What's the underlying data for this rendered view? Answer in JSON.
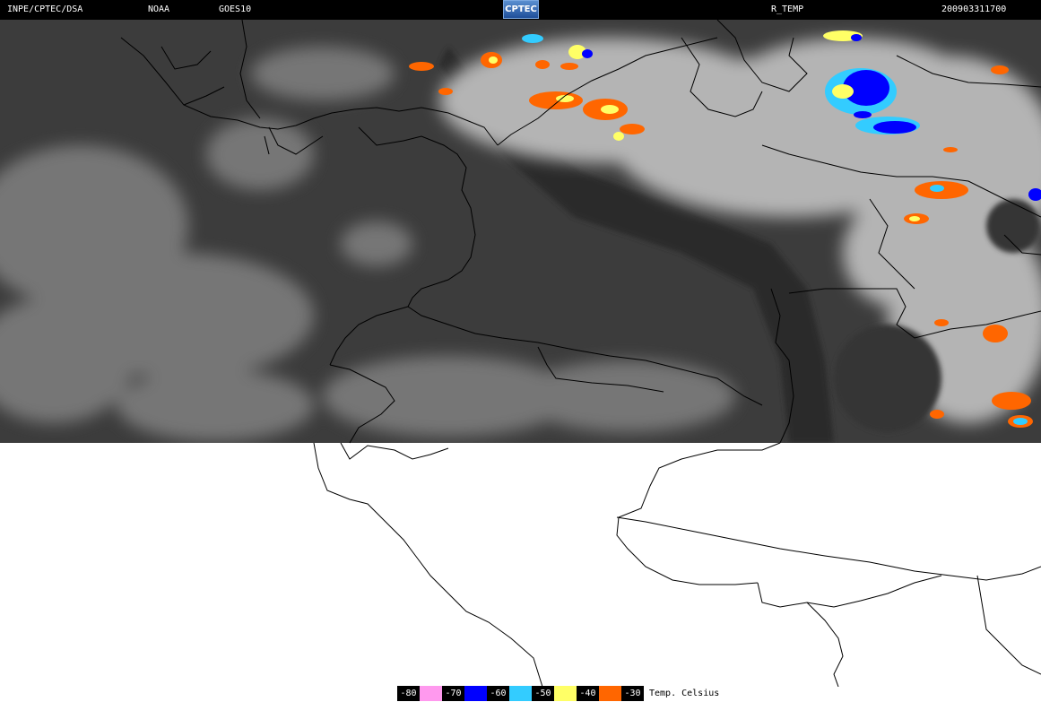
{
  "header": {
    "source": "INPE/CPTEC/DSA",
    "agency": "NOAA",
    "satellite": "GOES10",
    "logo": "CPTEC",
    "product": "R_TEMP",
    "timestamp": "200903311700"
  },
  "legend": {
    "items": [
      {
        "label": "-80",
        "color": "#ff99ee"
      },
      {
        "label": "-70",
        "color": "#0000ff"
      },
      {
        "label": "-60",
        "color": "#33ccff"
      },
      {
        "label": "-50",
        "color": "#ffff66"
      },
      {
        "label": "-40",
        "color": "#ff6600"
      },
      {
        "label": "-30",
        "color": ""
      }
    ],
    "unit": "Temp. Celsius"
  },
  "colors": {
    "ocean": "#3c3c3c",
    "cloud": "#b4b4b4",
    "border": "#000000",
    "nodata": "#ffffff"
  }
}
